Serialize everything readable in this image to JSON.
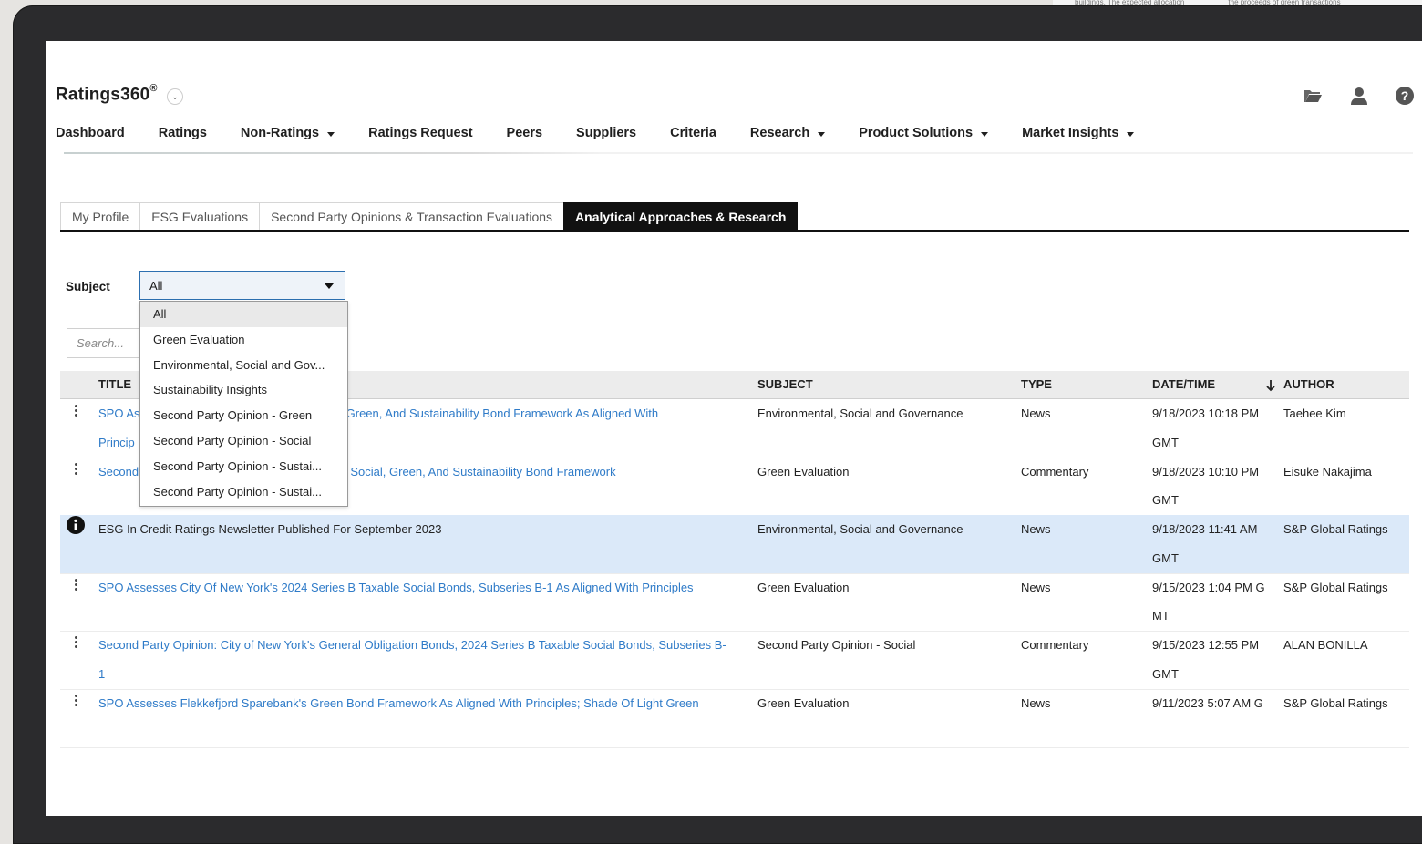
{
  "app": {
    "title": "Ratings360",
    "reg_mark": "®"
  },
  "top_strip": {
    "left_text": "buildings. The expected allocation",
    "right_text": "the proceeds of green transactions"
  },
  "nav": {
    "items": [
      {
        "label": "Dashboard",
        "has_menu": false
      },
      {
        "label": "Ratings",
        "has_menu": false
      },
      {
        "label": "Non-Ratings",
        "has_menu": true
      },
      {
        "label": "Ratings Request",
        "has_menu": false
      },
      {
        "label": "Peers",
        "has_menu": false
      },
      {
        "label": "Suppliers",
        "has_menu": false
      },
      {
        "label": "Criteria",
        "has_menu": false
      },
      {
        "label": "Research",
        "has_menu": true
      },
      {
        "label": "Product Solutions",
        "has_menu": true
      },
      {
        "label": "Market Insights",
        "has_menu": true
      }
    ]
  },
  "header_icons": [
    "folder-icon",
    "user-icon",
    "help-icon"
  ],
  "tabs": [
    {
      "label": "My Profile",
      "active": false
    },
    {
      "label": "ESG Evaluations",
      "active": false
    },
    {
      "label": "Second Party Opinions & Transaction Evaluations",
      "active": false
    },
    {
      "label": "Analytical Approaches & Research",
      "active": true
    }
  ],
  "filter": {
    "label": "Subject",
    "selected": "All",
    "options": [
      "All",
      "Green Evaluation",
      "Environmental, Social and Gov...",
      "Sustainability Insights",
      "Second Party Opinion - Green",
      "Second Party Opinion - Social",
      "Second Party Opinion - Sustai...",
      "Second Party Opinion - Sustai..."
    ]
  },
  "search": {
    "placeholder": "Search..."
  },
  "table": {
    "columns": {
      "title": "TITLE",
      "subject": "SUBJECT",
      "type": "TYPE",
      "date": "DATE/TIME",
      "author": "AUTHOR"
    },
    "rows": [
      {
        "title_start": "SPO As",
        "title_start_2": "Princip",
        "title": "Social, Green, And Sustainability Bond Framework As Aligned With",
        "subject": "Environmental, Social and Governance",
        "type": "News",
        "date": "9/18/2023 10:18 PM",
        "date_2": "GMT",
        "author": "Taehee Kim",
        "link": true,
        "icon": "kebab"
      },
      {
        "title_start": "Second",
        "title_start_2": "",
        "title": "Corp.'s Social, Green, And Sustainability Bond Framework",
        "subject": "Green Evaluation",
        "type": "Commentary",
        "date": "9/18/2023 10:10 PM",
        "date_2": "GMT",
        "author": "Eisuke Nakajima",
        "link": true,
        "icon": "kebab"
      },
      {
        "title_start": "",
        "title_start_2": "",
        "title": "ESG In Credit Ratings Newsletter Published For September 2023",
        "subject": "Environmental, Social and Governance",
        "type": "News",
        "date": "9/18/2023 11:41 AM",
        "date_2": "GMT",
        "author": "S&P Global Ratings",
        "link": false,
        "icon": "info",
        "highlight": true
      },
      {
        "title_start": "",
        "title_start_2": "",
        "title": "SPO Assesses City Of New York's 2024 Series B Taxable Social Bonds, Subseries B-1 As Aligned With Principles",
        "subject": "Green Evaluation",
        "type": "News",
        "date": "9/15/2023 1:04 PM G",
        "date_2": "MT",
        "author": "S&P Global Ratings",
        "link": true,
        "icon": "kebab"
      },
      {
        "title_start": "",
        "title_start_2": "",
        "title": "Second Party Opinion: City of New York's General Obligation Bonds, 2024 Series B Taxable Social Bonds, Subseries B-",
        "title_2": "1",
        "subject": "Second Party Opinion - Social",
        "type": "Commentary",
        "date": "9/15/2023 12:55 PM",
        "date_2": "GMT",
        "author": "ALAN BONILLA",
        "link": true,
        "icon": "kebab"
      },
      {
        "title_start": "",
        "title_start_2": "",
        "title": "SPO Assesses Flekkefjord Sparebank's Green Bond Framework As Aligned With Principles; Shade Of Light Green",
        "subject": "Green Evaluation",
        "type": "News",
        "date": "9/11/2023 5:07 AM G",
        "date_2": "",
        "author": "S&P Global Ratings",
        "link": true,
        "icon": "kebab"
      }
    ]
  }
}
